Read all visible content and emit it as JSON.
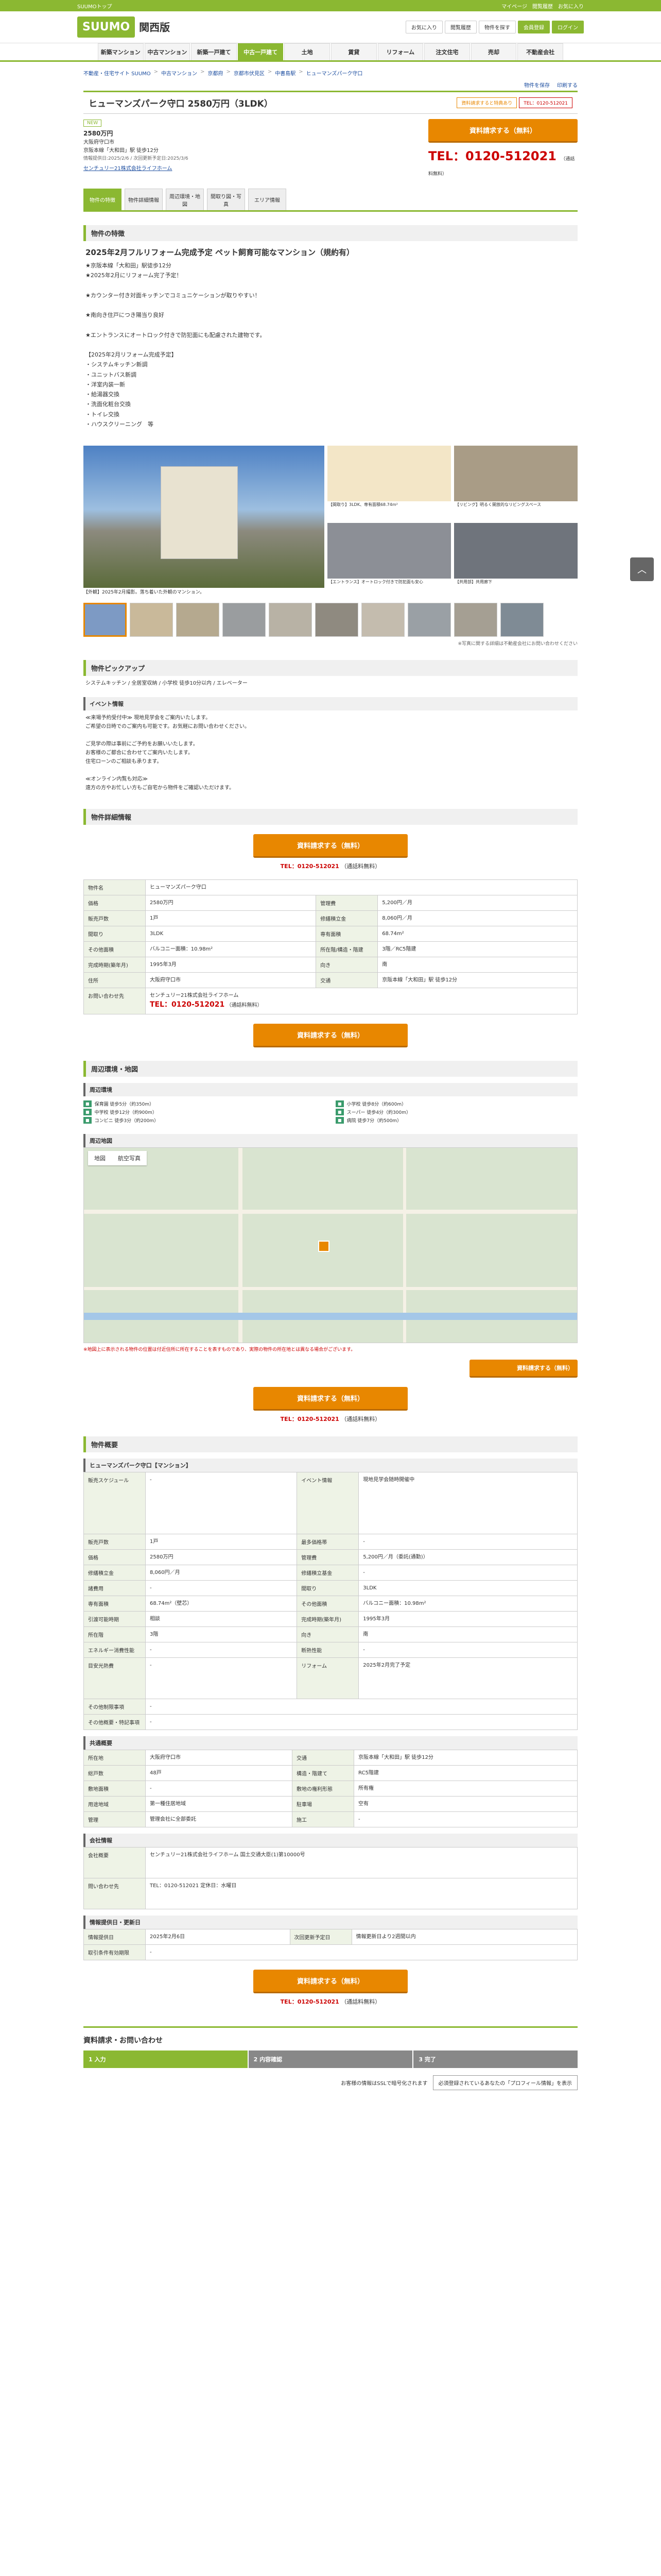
{
  "topbar": {
    "left": "SUUMOトップ",
    "items": [
      "マイページ",
      "閲覧履歴",
      "お気に入り"
    ]
  },
  "header": {
    "logo": "SUUMO",
    "area": "関西版",
    "buttons": [
      "お気に入り",
      "閲覧履歴",
      "物件を探す",
      "会員登録",
      "ログイン"
    ]
  },
  "gnav": [
    "新築マンション",
    "中古マンション",
    "新築一戸建て",
    "中古一戸建て",
    "土地",
    "賃貸",
    "リフォーム",
    "注文住宅",
    "売却",
    "不動産会社"
  ],
  "gnav_active": 3,
  "breadcrumb": [
    "不動産・住宅サイト SUUMO",
    "中古マンション",
    "京都府",
    "京都市伏見区",
    "中書島駅",
    "ヒューマンズパーク守口"
  ],
  "tools": [
    "物件を保存",
    "印刷する"
  ],
  "title": "ヒューマンズパーク守口 2580万円（3LDK）",
  "title_badges": [
    "資料請求すると特典あり",
    "TEL：0120-512021"
  ],
  "summary": {
    "new": "NEW",
    "price": "2580万円",
    "address": "大阪府守口市",
    "station": "京阪本線「大和田」駅 徒歩12分",
    "updated": "情報提供日:2025/2/6 / 次回更新予定日:2025/3/6",
    "company": "センチュリー21株式会社ライフホーム"
  },
  "cta": {
    "btn": "資料請求する（無料）",
    "tel": "TEL：0120-512021",
    "tel_note": "（通話料無料）"
  },
  "tabs": [
    "物件の特徴",
    "物件詳細情報",
    "周辺環境・地図",
    "間取り図・写真",
    "エリア情報"
  ],
  "features": {
    "heading": "物件の特徴",
    "catch": "2025年2月フルリフォーム完成予定 ペット飼育可能なマンション（規約有）",
    "lines": [
      "★京阪本線「大和田」駅徒歩12分",
      "",
      "★2025年2月にリフォーム完了予定！",
      "",
      "★カウンター付き対面キッチンでコミュニケーションが取りやすい！",
      "",
      "★南向き住戸につき陽当り良好",
      "",
      "★エントランスにオートロック付きで防犯面にも配慮された建物です。",
      "",
      "【2025年2月リフォーム完成予定】",
      "・システムキッチン新調",
      "・ユニットバス新調",
      "・洋室内装一新",
      "・給湯器交換",
      "・洗面化粧台交換",
      "・トイレ交換",
      "・ハウスクリーニング　等"
    ]
  },
  "photos": {
    "main_caption": "【外観】2025年2月撮影。落ち着いた外観のマンション。",
    "cells": [
      "【間取り】3LDK、専有面積68.74m²",
      "【リビング】明るく開放的なリビングスペース",
      "【エントランス】オートロック付きで防犯面も安心",
      "【共用部】共用廊下"
    ],
    "thumb_note": "※写真に関する詳細は不動産会社にお問い合わせください"
  },
  "pickup": {
    "heading": "物件ピックアップ",
    "text": "システムキッチン / 全居室収納 / 小学校 徒歩10分以内 / エレベーター"
  },
  "event": {
    "heading": "イベント情報",
    "lines": [
      "≪来場予約受付中≫ 現地見学会をご案内いたします。",
      "ご希望の日時でのご案内も可能です。お気軽にお問い合わせください。",
      "",
      "ご見学の際は事前にご予約をお願いいたします。",
      "お客様のご都合に合わせてご案内いたします。",
      "住宅ローンのご相談も承ります。",
      "",
      "≪オンライン内覧も対応≫",
      "遠方の方やお忙しい方もご自宅から物件をご確認いただけます。"
    ]
  },
  "spec_head": "物件詳細情報",
  "spec": [
    [
      "物件名",
      "ヒューマンズパーク守口",
      "",
      ""
    ],
    [
      "価格",
      "2580万円",
      "管理費",
      "5,200円／月"
    ],
    [
      "販売戸数",
      "1戸",
      "修繕積立金",
      "8,060円／月"
    ],
    [
      "間取り",
      "3LDK",
      "専有面積",
      "68.74m²"
    ],
    [
      "その他面積",
      "バルコニー面積：10.98m²",
      "所在階/構造・階建",
      "3階／RC5階建"
    ],
    [
      "完成時期(築年月)",
      "1995年3月",
      "向き",
      "南"
    ],
    [
      "住所",
      "大阪府守口市",
      "交通",
      "京阪本線「大和田」駅 徒歩12分"
    ]
  ],
  "company": {
    "label": "お問い合わせ先",
    "name": "センチュリー21株式会社ライフホーム",
    "tel": "TEL：0120-512021",
    "note": "（通話料無料）"
  },
  "nearby": {
    "heading": "周辺環境・地図",
    "sub1": "周辺環境",
    "items": [
      "保育園 徒歩5分（約350m）",
      "小学校 徒歩8分（約600m）",
      "中学校 徒歩12分（約900m）",
      "スーパー 徒歩4分（約300m）",
      "コンビニ 徒歩3分（約200m）",
      "病院 徒歩7分（約500m）"
    ],
    "sub2": "周辺地図",
    "map_tabs": [
      "地図",
      "航空写真"
    ],
    "map_note": "※地図上に表示される物件の位置は付近住所に所在することを表すものであり、実際の物件の所在地とは異なる場合がございます。"
  },
  "overview": {
    "heading": "物件概要",
    "name": "ヒューマンズパーク守口【マンション】",
    "rows": [
      [
        "販売スケジュール",
        "-",
        "イベント情報",
        "現地見学会随時開催中"
      ],
      [
        "販売戸数",
        "1戸",
        "最多価格帯",
        "-"
      ],
      [
        "価格",
        "2580万円",
        "管理費",
        "5,200円／月（委託(通勤)）"
      ],
      [
        "修繕積立金",
        "8,060円／月",
        "修繕積立基金",
        "-"
      ],
      [
        "諸費用",
        "-",
        "間取り",
        "3LDK"
      ],
      [
        "専有面積",
        "68.74m²（壁芯）",
        "その他面積",
        "バルコニー面積：10.98m²"
      ],
      [
        "引渡可能時期",
        "相談",
        "完成時期(築年月)",
        "1995年3月"
      ],
      [
        "所在階",
        "3階",
        "向き",
        "南"
      ],
      [
        "エネルギー消費性能",
        "-",
        "断熱性能",
        "-"
      ],
      [
        "目安光熱費",
        "-",
        "リフォーム",
        "2025年2月完了予定"
      ],
      [
        "その他制限事項",
        "-",
        "",
        ""
      ],
      [
        "その他概要・特記事項",
        "-",
        "",
        ""
      ]
    ],
    "common_head": "共通概要",
    "common": [
      [
        "所在地",
        "大阪府守口市",
        "交通",
        "京阪本線「大和田」駅 徒歩12分"
      ],
      [
        "総戸数",
        "48戸",
        "構造・階建て",
        "RC5階建"
      ],
      [
        "敷地面積",
        "-",
        "敷地の権利形態",
        "所有権"
      ],
      [
        "用途地域",
        "第一種住居地域",
        "駐車場",
        "空有"
      ],
      [
        "管理",
        "管理会社に全部委託",
        "施工",
        "-"
      ]
    ],
    "company_head": "会社情報",
    "company_rows": [
      [
        "会社概要",
        "センチュリー21株式会社ライフホーム 国土交通大臣(1)第10000号"
      ],
      [
        "問い合わせ先",
        "TEL：0120-512021 定休日：水曜日"
      ]
    ],
    "info_head": "情報提供日・更新日",
    "info": [
      [
        "情報提供日",
        "2025年2月6日",
        "次回更新予定日",
        "情報更新日より2週間以内"
      ],
      [
        "取引条件有効期限",
        "-",
        "",
        ""
      ]
    ]
  },
  "footer": {
    "heading": "資料請求・お問い合わせ",
    "steps": [
      "1 入力",
      "2 内容確認",
      "3 完了"
    ],
    "note": "お客様の情報はSSLで暗号化されます",
    "box": "必須登録されているあなたの「プロフィール情報」を表示"
  },
  "pagetop": "︿"
}
